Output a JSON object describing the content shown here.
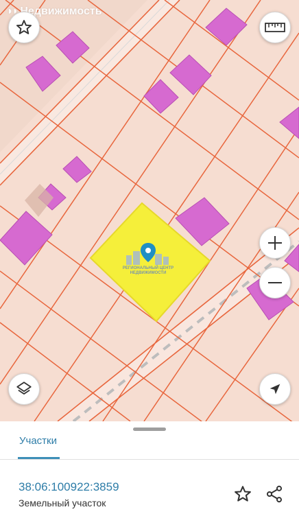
{
  "map": {
    "watermark_text": "Недвижимость",
    "center_logo_line1": "РЕГИОНАЛЬНЫЙ ЦЕНТР",
    "center_logo_line2": "НЕДВИЖИМОСТИ",
    "colors": {
      "background": "#f6ddd1",
      "boundary": "#e8663d",
      "building": "#d66ad0",
      "selected_parcel": "#f5ef3a",
      "road_dash": "#bdbdbd",
      "pin": "#1f8fc4"
    }
  },
  "buttons": {
    "favorite": "star-icon",
    "ruler": "ruler-icon",
    "zoom_in": "plus-icon",
    "zoom_out": "minus-icon",
    "layers": "layers-icon",
    "locate": "navigation-arrow-icon"
  },
  "sheet": {
    "tab_label": "Участки",
    "cadastral_number": "38:06:100922:3859",
    "parcel_type": "Земельный участок"
  }
}
